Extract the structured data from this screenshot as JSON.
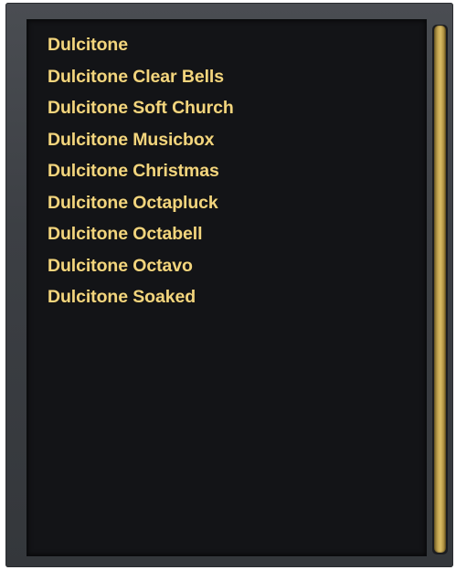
{
  "preset_list": {
    "items": [
      {
        "label": "Dulcitone"
      },
      {
        "label": "Dulcitone Clear Bells"
      },
      {
        "label": "Dulcitone Soft Church"
      },
      {
        "label": "Dulcitone Musicbox"
      },
      {
        "label": "Dulcitone Christmas"
      },
      {
        "label": "Dulcitone Octapluck"
      },
      {
        "label": "Dulcitone Octabell"
      },
      {
        "label": "Dulcitone Octavo"
      },
      {
        "label": "Dulcitone Soaked"
      }
    ]
  },
  "colors": {
    "text": "#f2d57e",
    "panel_background": "#131417",
    "frame": "#3c3f44",
    "scroll_thumb": "#c9aa55"
  }
}
